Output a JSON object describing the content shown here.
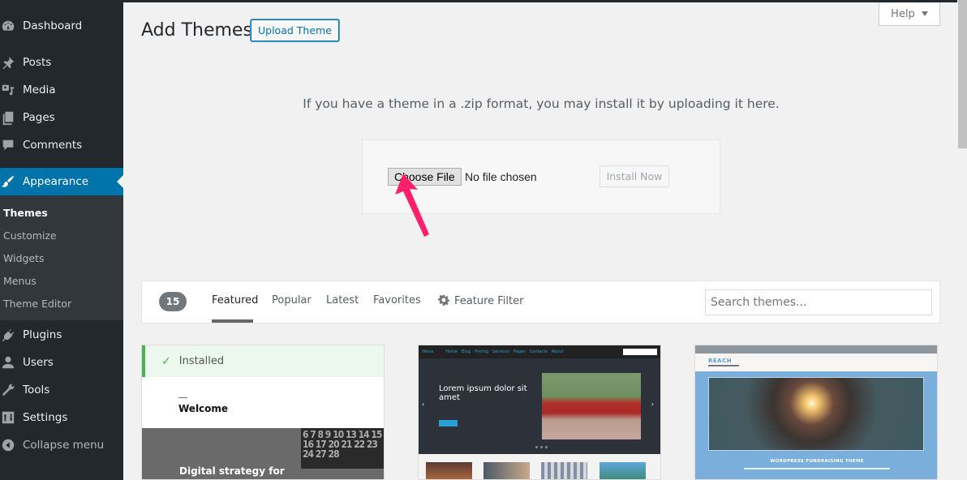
{
  "sidebar": {
    "items": [
      {
        "label": "Dashboard",
        "icon": "dashboard-icon"
      },
      {
        "label": "Posts",
        "icon": "pin-icon"
      },
      {
        "label": "Media",
        "icon": "media-icon"
      },
      {
        "label": "Pages",
        "icon": "pages-icon"
      },
      {
        "label": "Comments",
        "icon": "comment-icon"
      },
      {
        "label": "Appearance",
        "icon": "paintbrush-icon",
        "active": true
      },
      {
        "label": "Plugins",
        "icon": "plugin-icon"
      },
      {
        "label": "Users",
        "icon": "user-icon"
      },
      {
        "label": "Tools",
        "icon": "wrench-icon"
      },
      {
        "label": "Settings",
        "icon": "settings-icon"
      },
      {
        "label": "Collapse menu",
        "icon": "collapse-icon"
      }
    ],
    "submenu": [
      {
        "label": "Themes",
        "current": true
      },
      {
        "label": "Customize"
      },
      {
        "label": "Widgets"
      },
      {
        "label": "Menus"
      },
      {
        "label": "Theme Editor"
      }
    ]
  },
  "header": {
    "title": "Add Themes",
    "upload_button": "Upload Theme",
    "help_button": "Help"
  },
  "upload": {
    "description": "If you have a theme in a .zip format, you may install it by uploading it here.",
    "choose_file": "Choose File",
    "no_file": "No file chosen",
    "install_button": "Install Now",
    "annotation_color": "#ff1f6b"
  },
  "filter": {
    "count": "15",
    "tabs": [
      "Featured",
      "Popular",
      "Latest",
      "Favorites"
    ],
    "current_tab": "Featured",
    "feature_filter": "Feature Filter",
    "search_placeholder": "Search themes..."
  },
  "themes": [
    {
      "installed_label": "Installed",
      "preview_welcome": "Welcome",
      "preview_heading": "Digital strategy for",
      "preview_calendar": "6 7 8 9 10 13 14 15 16 17 20 21 22 23 24 27 28"
    },
    {
      "preview_logo": "iNova",
      "preview_nav": [
        "Home",
        "Blog",
        "Pricing",
        "Services",
        "Pages",
        "Contacts",
        "About"
      ],
      "preview_title": "Lorem ipsum dolor sit amet"
    },
    {
      "preview_logo": "REACH",
      "preview_heading": "WORDPRESS FUNDRAISING THEME"
    }
  ],
  "colors": {
    "sidebar_bg": "#23282d",
    "active_menu": "#0073aa",
    "installed_green": "#46b450"
  }
}
